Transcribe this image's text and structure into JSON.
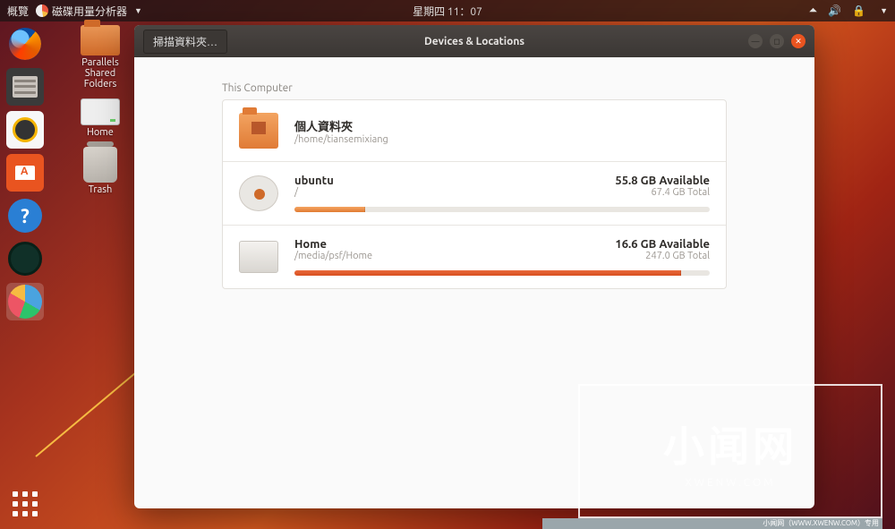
{
  "panel": {
    "activities": "概覽",
    "app_name": "磁碟用量分析器",
    "clock": "星期四 11：07"
  },
  "desktop": {
    "parallels": "Parallels\nShared\nFolders",
    "home": "Home",
    "trash": "Trash"
  },
  "window": {
    "scan_button": "掃描資料夾…",
    "title": "Devices & Locations",
    "section": "This Computer",
    "rows": [
      {
        "name": "個人資料夾",
        "path": "/home/tiansemixiang",
        "avail": "",
        "total": "",
        "pct": 0
      },
      {
        "name": "ubuntu",
        "path": "/",
        "avail": "55.8 GB Available",
        "total": "67.4 GB Total",
        "pct": 17
      },
      {
        "name": "Home",
        "path": "/media/psf/Home",
        "avail": "16.6 GB Available",
        "total": "247.0 GB Total",
        "pct": 93
      }
    ]
  },
  "watermark": {
    "big": "小闻网",
    "sub": "XWENW.COM",
    "strip": "小闻网（WWW.XWENW.COM）专用"
  }
}
